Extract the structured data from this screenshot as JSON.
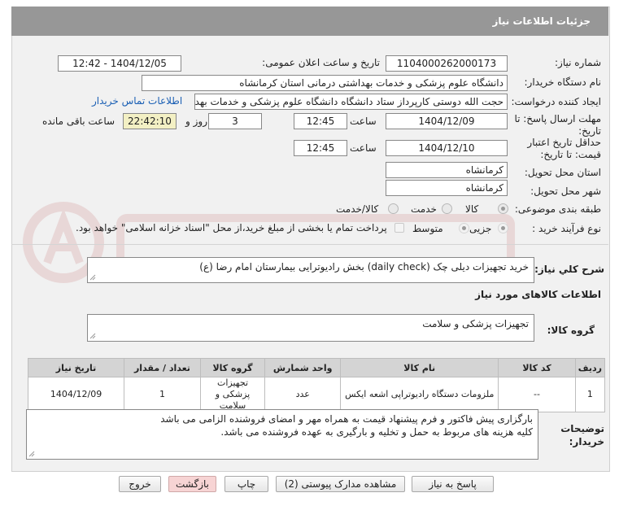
{
  "header": {
    "title": "جزئیات اطلاعات نیاز"
  },
  "form": {
    "need_number_label": "شماره نیاز:",
    "need_number": "1104000262000173",
    "announce_label": "تاریخ و ساعت اعلان عمومی:",
    "announce_value": "1404/12/05 - 12:42",
    "buyer_org_label": "نام دستگاه خریدار:",
    "buyer_org": "دانشگاه علوم پزشکی و خدمات بهداشتی  درمانی استان کرمانشاه",
    "creator_label": "ایجاد کننده درخواست:",
    "creator": "حجت الله دوستی  کارپرداز ستاد دانشگاه دانشگاه علوم پزشکی و خدمات بهداشتی",
    "contact_link": "اطلاعات تماس خریدار",
    "deadline_label_1": "مهلت ارسال پاسخ: تا",
    "deadline_label_2": "تاریخ:",
    "deadline_date": "1404/12/09",
    "time_label": "ساعت",
    "deadline_time": "12:45",
    "days_value": "3",
    "days_label": "روز و",
    "remaining_value": "22:42:10",
    "remaining_label": "ساعت باقی مانده",
    "validity_label_1": "حداقل تاریخ اعتبار",
    "validity_label_2": "قیمت: تا تاریخ:",
    "validity_date": "1404/12/10",
    "validity_time": "12:45",
    "province_label": "استان محل تحویل:",
    "province": "کرمانشاه",
    "city_label": "شهر محل تحویل:",
    "city": "کرمانشاه",
    "category_label": "طبقه بندی موضوعی:",
    "category_options": [
      "کالا",
      "خدمت",
      "کالا/خدمت"
    ],
    "category_selected": "کالا",
    "process_label": "نوع فرآیند خرید :",
    "process_options": [
      "جزیی",
      "متوسط"
    ],
    "process_selected": "جزیی",
    "treasury_text": "پرداخت تمام یا بخشی از مبلغ خرید،از محل \"اسناد خزانه اسلامی\" خواهد بود."
  },
  "description": {
    "label": "شرح کلي نياز:",
    "value": "خرید تجهیزات دیلی چک (daily check) بخش رادیوترایی بیمارستان امام رضا (ع)"
  },
  "goods": {
    "section_title": "اطلاعات کالاهای مورد نیاز",
    "group_label": "گروه کالا:",
    "group_value": "تجهیزات پزشکی و سلامت"
  },
  "table": {
    "headers": [
      "ردیف",
      "کد کالا",
      "نام کالا",
      "واحد شمارش",
      "گروه کالا",
      "تعداد / مقدار",
      "تاریخ نیاز"
    ],
    "rows": [
      [
        "1",
        "--",
        "ملزومات دستگاه رادیوتراپی اشعه ایکس",
        "عدد",
        "تجهیزات پزشکی و سلامت",
        "1",
        "1404/12/09"
      ]
    ]
  },
  "buyer_notes": {
    "label_1": "توضیحات",
    "label_2": "خریدار:",
    "line_1": "بارگزاری پیش فاکتور و فرم پیشنهاد قیمت به همراه مهر و امضای فروشنده  الزامی می باشد",
    "line_2": "کلیه هزینه های مربوط به حمل و تخلیه و بارگیری به عهده فروشنده می باشد."
  },
  "buttons": {
    "reply": "پاسخ به نیاز",
    "attachments": "مشاهده مدارک پیوستی (2)",
    "print": "چاپ",
    "back": "بازگشت",
    "exit": "خروج"
  },
  "colors": {
    "header_bg": "#979797",
    "panel_bg": "#f1f1f1",
    "link": "#1a5fb4",
    "highlight": "#f3f0c4",
    "pink_button": "#f7d4d4"
  }
}
